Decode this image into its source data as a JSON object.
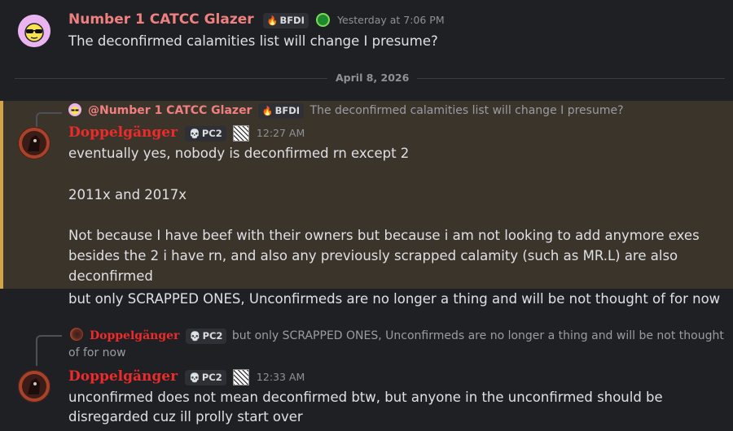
{
  "msg1": {
    "author": "Number 1 CATCC Glazer",
    "tag": "BFDI",
    "time": "Yesterday at 7:06 PM",
    "text": "The deconfirmed calamities list will change I presume?"
  },
  "divider": {
    "date": "April 8, 2026"
  },
  "msg2": {
    "reply": {
      "author": "@Number 1 CATCC Glazer",
      "tag": "BFDI",
      "text": "The deconfirmed calamities list will change I presume?"
    },
    "author": "Doppelgänger",
    "tag": "PC2",
    "time": "12:27 AM",
    "lines": [
      "eventually yes, nobody is deconfirmed rn except 2",
      "",
      "2011x and 2017x",
      "",
      "Not because I have beef with their owners but because i am not looking to add anymore exes",
      "besides the 2 i have rn, and also any previously scrapped calamity (such as MR.L) are also",
      "deconfirmed"
    ],
    "followup": "but only SCRAPPED ONES, Unconfirmeds are no longer a thing and will be not thought of for now"
  },
  "msg3": {
    "reply": {
      "author": "Doppelgänger",
      "tag": "PC2",
      "text_line1": "but only SCRAPPED ONES, Unconfirmeds are no longer a thing and will be not thought",
      "text_line2": "of for now"
    },
    "author": "Doppelgänger",
    "tag": "PC2",
    "time": "12:33 AM",
    "lines": [
      "unconfirmed does not mean deconfirmed btw, but anyone in the unconfirmed should be",
      "disregarded cuz ill prolly start over"
    ]
  },
  "colors": {
    "background": "#1f2023",
    "highlight": "#3a342b",
    "highlight_border": "#d3a54a",
    "glazer_name": "#f08080",
    "doppel_name": "#ed2b2b"
  },
  "icons": {
    "tag_emoji": "fire-icon",
    "doppel_tag_emoji": "skull-icon",
    "glazer_badge": "green-circle-badge-icon",
    "doppel_badge": "sketch-image-badge-icon"
  }
}
